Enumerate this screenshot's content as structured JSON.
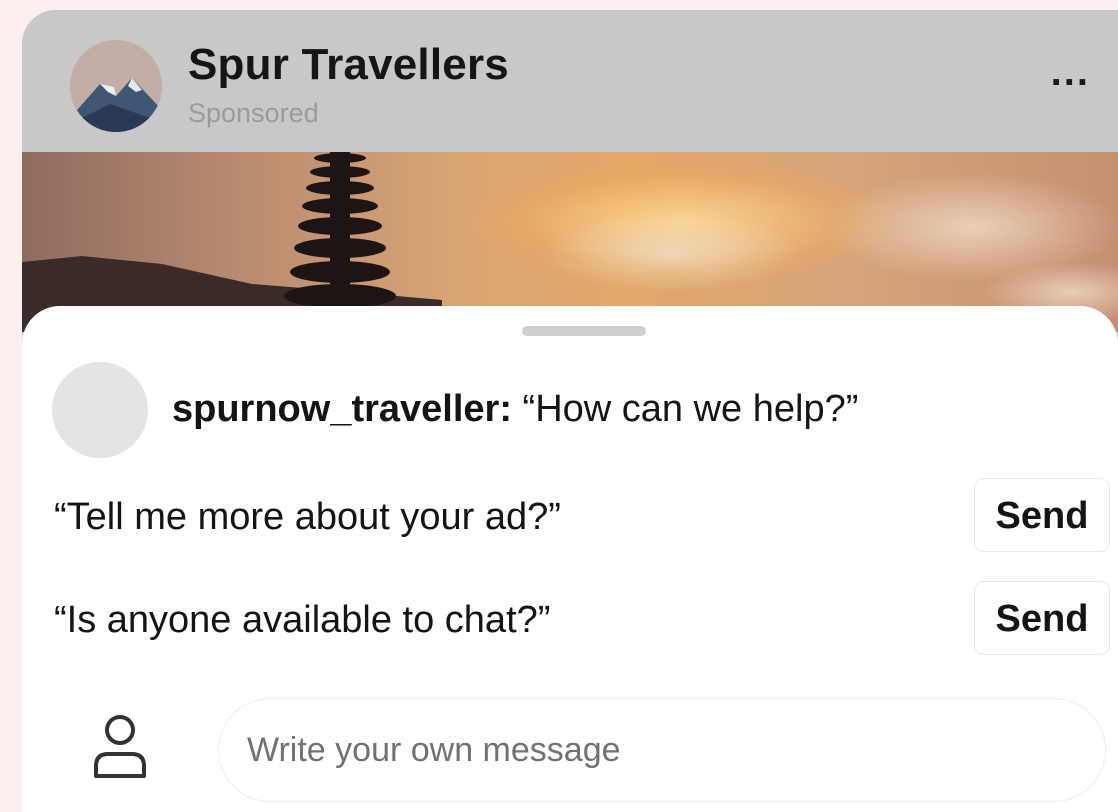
{
  "post": {
    "brand_name": "Spur Travellers",
    "sponsored_label": "Sponsored",
    "more_label": "..."
  },
  "chat": {
    "bot_username": "spurnow_traveller:",
    "bot_message": " “How can we help?”",
    "suggestions": [
      {
        "text": "“Tell me more about your ad?”",
        "send_label": "Send"
      },
      {
        "text": "“Is anyone available to chat?”",
        "send_label": "Send"
      }
    ],
    "input_placeholder": "Write your own message"
  },
  "colors": {
    "page_background": "#fbeeee",
    "header_background": "#c8c8c8",
    "sheet_background": "#ffffff"
  },
  "icons": [
    "mountain-avatar-icon",
    "more-options-icon",
    "user-icon"
  ]
}
